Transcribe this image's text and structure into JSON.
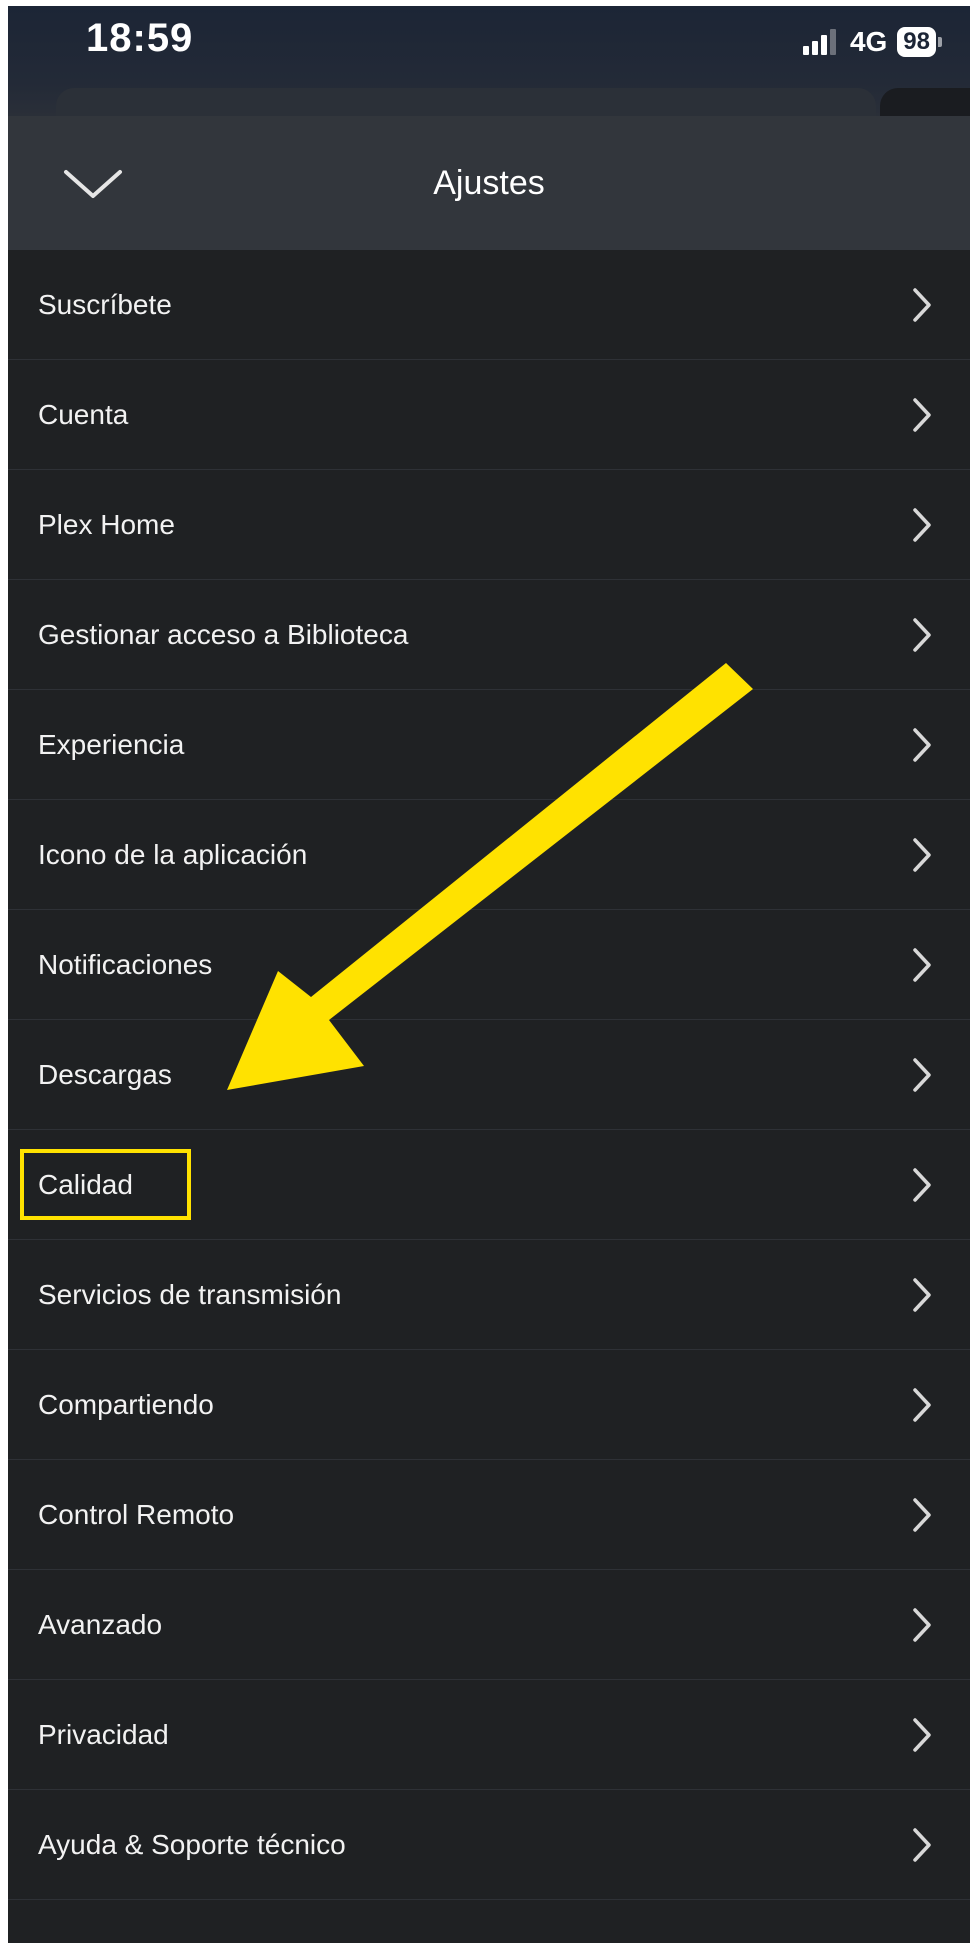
{
  "status_bar": {
    "time": "18:59",
    "network": "4G",
    "battery": "98"
  },
  "header": {
    "title": "Ajustes",
    "collapse_icon": "chevron-down-icon"
  },
  "settings": {
    "chevron_icon": "chevron-right-icon",
    "items": [
      {
        "label": "Suscríbete"
      },
      {
        "label": "Cuenta"
      },
      {
        "label": "Plex Home"
      },
      {
        "label": "Gestionar acceso a Biblioteca"
      },
      {
        "label": "Experiencia"
      },
      {
        "label": "Icono de la aplicación"
      },
      {
        "label": "Notificaciones"
      },
      {
        "label": "Descargas"
      },
      {
        "label": "Calidad"
      },
      {
        "label": "Servicios de transmisión"
      },
      {
        "label": "Compartiendo"
      },
      {
        "label": "Control Remoto"
      },
      {
        "label": "Avanzado"
      },
      {
        "label": "Privacidad"
      },
      {
        "label": "Ayuda & Soporte técnico"
      }
    ]
  },
  "annotation": {
    "highlight_color": "#ffe200",
    "highlighted_item": "Calidad"
  },
  "colors": {
    "background": "#1f2123",
    "header": "#32363c",
    "divider": "#2e3136",
    "text": "#f2f2f2",
    "chevron": "#d8d8d8"
  }
}
